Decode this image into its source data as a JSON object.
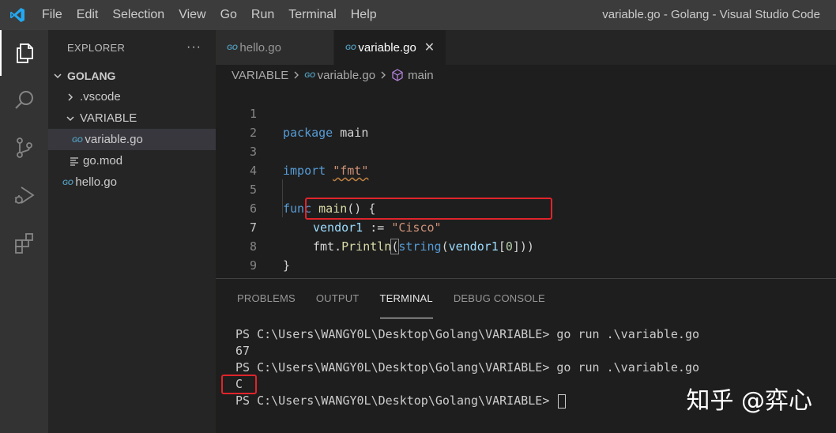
{
  "window": {
    "title": "variable.go - Golang - Visual Studio Code",
    "menu": [
      "File",
      "Edit",
      "Selection",
      "View",
      "Go",
      "Run",
      "Terminal",
      "Help"
    ]
  },
  "activity_bar": {
    "icons": [
      "explorer-icon",
      "search-icon",
      "source-control-icon",
      "run-debug-icon",
      "extensions-icon"
    ]
  },
  "explorer": {
    "title": "EXPLORER",
    "more": "···",
    "root": "GOLANG",
    "items": [
      {
        "label": ".vscode",
        "type": "folder",
        "expanded": false
      },
      {
        "label": "VARIABLE",
        "type": "folder",
        "expanded": true
      },
      {
        "label": "variable.go",
        "type": "go-file",
        "selected": true
      },
      {
        "label": "go.mod",
        "type": "mod-file"
      },
      {
        "label": "hello.go",
        "type": "go-file"
      }
    ],
    "go_badge": "GO"
  },
  "tabs": [
    {
      "label": "hello.go",
      "active": false
    },
    {
      "label": "variable.go",
      "active": true,
      "close": "✕"
    }
  ],
  "breadcrumb": {
    "folder": "VARIABLE",
    "file": "variable.go",
    "symbol": "main"
  },
  "code": {
    "line_numbers": [
      "1",
      "2",
      "3",
      "4",
      "5",
      "6",
      "7",
      "8",
      "9"
    ],
    "current_line": 7,
    "l1_kw": "package",
    "l1_name": " main",
    "l3_kw": "import",
    "l3_str": "\"fmt\"",
    "l5_kw": "func",
    "l5_fn": "main",
    "l5_rest": "() {",
    "l6_var": "vendor1",
    "l6_op": " := ",
    "l6_str": "\"Cisco\"",
    "l7_pkg": "fmt",
    "l7_dot": ".",
    "l7_fn": "Println",
    "l7_p1": "(",
    "l7_conv": "string",
    "l7_p2": "(",
    "l7_var": "vendor1",
    "l7_b1": "[",
    "l7_num": "0",
    "l7_b2": "]",
    "l7_p3": "))",
    "l8": "}"
  },
  "panel": {
    "tabs": [
      "PROBLEMS",
      "OUTPUT",
      "TERMINAL",
      "DEBUG CONSOLE"
    ],
    "active_tab": "TERMINAL",
    "terminal_lines": [
      "PS C:\\Users\\WANGY0L\\Desktop\\Golang\\VARIABLE> go run .\\variable.go",
      "67",
      "PS C:\\Users\\WANGY0L\\Desktop\\Golang\\VARIABLE> go run .\\variable.go",
      "C",
      "PS C:\\Users\\WANGY0L\\Desktop\\Golang\\VARIABLE> "
    ]
  },
  "watermark": "知乎 @弈心",
  "colors": {
    "accent_blue": "#569cd6",
    "go_blue": "#519aba",
    "annotation_red": "#e0242b"
  }
}
